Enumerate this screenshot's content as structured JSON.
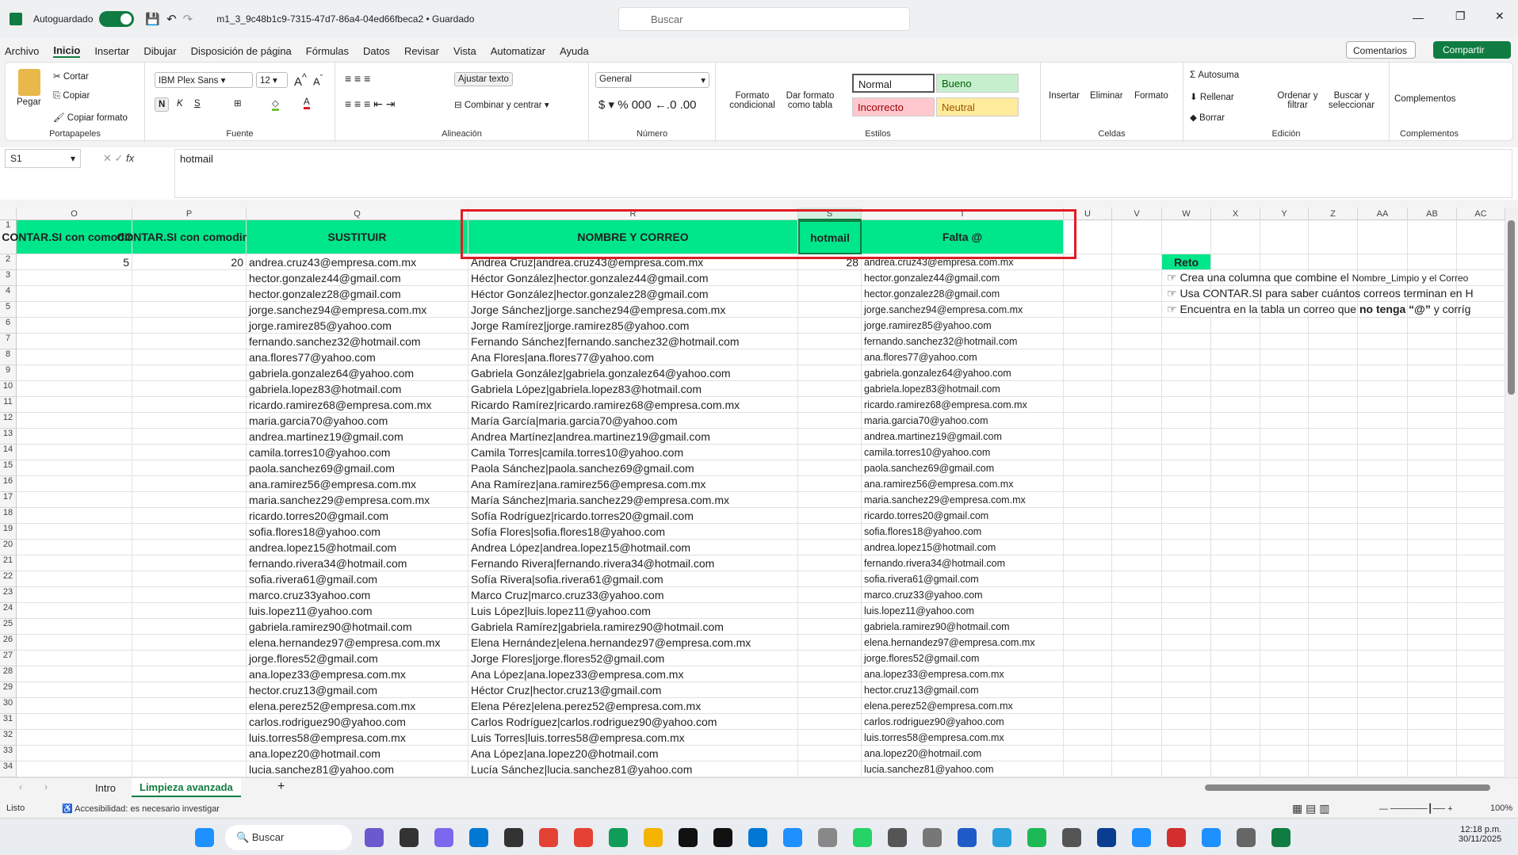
{
  "titlebar": {
    "autosave": "Autoguardado",
    "filename": "m1_3_9c48b1c9-7315-47d7-86a4-04ed66fbeca2 • Guardado",
    "search_placeholder": "Buscar"
  },
  "menu": [
    "Archivo",
    "Inicio",
    "Insertar",
    "Dibujar",
    "Disposición de página",
    "Fórmulas",
    "Datos",
    "Revisar",
    "Vista",
    "Automatizar",
    "Ayuda"
  ],
  "menu_active": "Inicio",
  "actions": {
    "comments": "Comentarios",
    "share": "Compartir"
  },
  "ribbon": {
    "clipboard": {
      "paste": "Pegar",
      "cut": "Cortar",
      "copy": "Copiar",
      "format_painter": "Copiar formato",
      "label": "Portapapeles"
    },
    "font": {
      "family": "IBM Plex Sans",
      "size": "12",
      "bold": "N",
      "italic": "K",
      "underline": "S",
      "label": "Fuente"
    },
    "alignment": {
      "wrap": "Ajustar texto",
      "merge": "Combinar y centrar",
      "label": "Alineación"
    },
    "number": {
      "format": "General",
      "label": "Número"
    },
    "styles": {
      "conditional": "Formato condicional",
      "table": "Dar formato como tabla",
      "normal": "Normal",
      "good": "Bueno",
      "bad": "Incorrecto",
      "neutral": "Neutral",
      "label": "Estilos"
    },
    "cells": {
      "insert": "Insertar",
      "delete": "Eliminar",
      "format": "Formato",
      "label": "Celdas"
    },
    "editing": {
      "autosum": "Autosuma",
      "fill": "Rellenar",
      "clear": "Borrar",
      "sort": "Ordenar y filtrar",
      "find": "Buscar y seleccionar",
      "label": "Edición"
    },
    "addins": {
      "addins": "Complementos",
      "label": "Complementos"
    }
  },
  "formula_bar": {
    "cell": "S1",
    "formula": "hotmail"
  },
  "columns": [
    "O",
    "P",
    "Q",
    "R",
    "S",
    "T",
    "U",
    "V",
    "W",
    "X",
    "Y",
    "Z",
    "AA",
    "AB",
    "AC"
  ],
  "headers": {
    "O": "CONTAR.SI con comodines",
    "P": "CONTAR.SI con comodines",
    "Q": "SUSTITUIR",
    "R": "NOMBRE Y CORREO",
    "S": "hotmail",
    "T": "Falta @"
  },
  "row2": {
    "O": "5",
    "P": "20",
    "S": "28"
  },
  "rows": [
    [
      "andrea.cruz43@empresa.com.mx",
      "Andrea Cruz|andrea.cruz43@empresa.com.mx",
      "andrea.cruz43@empresa.com.mx"
    ],
    [
      "hector.gonzalez44@gmail.com",
      "Héctor González|hector.gonzalez44@gmail.com",
      "hector.gonzalez44@gmail.com"
    ],
    [
      "hector.gonzalez28@gmail.com",
      "Héctor González|hector.gonzalez28@gmail.com",
      "hector.gonzalez28@gmail.com"
    ],
    [
      "jorge.sanchez94@empresa.com.mx",
      "Jorge Sánchez|jorge.sanchez94@empresa.com.mx",
      "jorge.sanchez94@empresa.com.mx"
    ],
    [
      "jorge.ramirez85@yahoo.com",
      "Jorge Ramírez|jorge.ramirez85@yahoo.com",
      "jorge.ramirez85@yahoo.com"
    ],
    [
      "fernando.sanchez32@hotmail.com",
      "Fernando Sánchez|fernando.sanchez32@hotmail.com",
      "fernando.sanchez32@hotmail.com"
    ],
    [
      "ana.flores77@yahoo.com",
      "Ana Flores|ana.flores77@yahoo.com",
      "ana.flores77@yahoo.com"
    ],
    [
      "gabriela.gonzalez64@yahoo.com",
      "Gabriela González|gabriela.gonzalez64@yahoo.com",
      "gabriela.gonzalez64@yahoo.com"
    ],
    [
      "gabriela.lopez83@hotmail.com",
      "Gabriela López|gabriela.lopez83@hotmail.com",
      "gabriela.lopez83@hotmail.com"
    ],
    [
      "ricardo.ramirez68@empresa.com.mx",
      "Ricardo Ramírez|ricardo.ramirez68@empresa.com.mx",
      "ricardo.ramirez68@empresa.com.mx"
    ],
    [
      "maria.garcia70@yahoo.com",
      "María García|maria.garcia70@yahoo.com",
      "maria.garcia70@yahoo.com"
    ],
    [
      "andrea.martinez19@gmail.com",
      "Andrea Martínez|andrea.martinez19@gmail.com",
      "andrea.martinez19@gmail.com"
    ],
    [
      "camila.torres10@yahoo.com",
      "Camila Torres|camila.torres10@yahoo.com",
      "camila.torres10@yahoo.com"
    ],
    [
      "paola.sanchez69@gmail.com",
      "Paola Sánchez|paola.sanchez69@gmail.com",
      "paola.sanchez69@gmail.com"
    ],
    [
      "ana.ramirez56@empresa.com.mx",
      "Ana Ramírez|ana.ramirez56@empresa.com.mx",
      "ana.ramirez56@empresa.com.mx"
    ],
    [
      "maria.sanchez29@empresa.com.mx",
      "María Sánchez|maria.sanchez29@empresa.com.mx",
      "maria.sanchez29@empresa.com.mx"
    ],
    [
      "ricardo.torres20@gmail.com",
      "Sofía Rodríguez|ricardo.torres20@gmail.com",
      "ricardo.torres20@gmail.com"
    ],
    [
      "sofia.flores18@yahoo.com",
      "Sofía Flores|sofia.flores18@yahoo.com",
      "sofia.flores18@yahoo.com"
    ],
    [
      "andrea.lopez15@hotmail.com",
      "Andrea López|andrea.lopez15@hotmail.com",
      "andrea.lopez15@hotmail.com"
    ],
    [
      "fernando.rivera34@hotmail.com",
      "Fernando Rivera|fernando.rivera34@hotmail.com",
      "fernando.rivera34@hotmail.com"
    ],
    [
      "sofia.rivera61@gmail.com",
      "Sofía Rivera|sofia.rivera61@gmail.com",
      "sofia.rivera61@gmail.com"
    ],
    [
      "marco.cruz33yahoo.com",
      "Marco Cruz|marco.cruz33@yahoo.com",
      "marco.cruz33@yahoo.com"
    ],
    [
      "luis.lopez11@yahoo.com",
      "Luis López|luis.lopez11@yahoo.com",
      "luis.lopez11@yahoo.com"
    ],
    [
      "gabriela.ramirez90@hotmail.com",
      "Gabriela Ramírez|gabriela.ramirez90@hotmail.com",
      "gabriela.ramirez90@hotmail.com"
    ],
    [
      "elena.hernandez97@empresa.com.mx",
      "Elena Hernández|elena.hernandez97@empresa.com.mx",
      "elena.hernandez97@empresa.com.mx"
    ],
    [
      "jorge.flores52@gmail.com",
      "Jorge Flores|jorge.flores52@gmail.com",
      "jorge.flores52@gmail.com"
    ],
    [
      "ana.lopez33@empresa.com.mx",
      "Ana López|ana.lopez33@empresa.com.mx",
      "ana.lopez33@empresa.com.mx"
    ],
    [
      "hector.cruz13@gmail.com",
      "Héctor Cruz|hector.cruz13@gmail.com",
      "hector.cruz13@gmail.com"
    ],
    [
      "elena.perez52@empresa.com.mx",
      "Elena Pérez|elena.perez52@empresa.com.mx",
      "elena.perez52@empresa.com.mx"
    ],
    [
      "carlos.rodriguez90@yahoo.com",
      "Carlos Rodríguez|carlos.rodriguez90@yahoo.com",
      "carlos.rodriguez90@yahoo.com"
    ],
    [
      "luis.torres58@empresa.com.mx",
      "Luis Torres|luis.torres58@empresa.com.mx",
      "luis.torres58@empresa.com.mx"
    ],
    [
      "ana.lopez20@hotmail.com",
      "Ana López|ana.lopez20@hotmail.com",
      "ana.lopez20@hotmail.com"
    ],
    [
      "lucia.sanchez81@yahoo.com",
      "Lucía Sánchez|lucia.sanchez81@yahoo.com",
      "lucia.sanchez81@yahoo.com"
    ]
  ],
  "reto": {
    "title": "Reto",
    "lines": [
      {
        "pre": "Crea una columna que combine el ",
        "small": "Nombre_Limpio y el Correo",
        "bold": "",
        "post": ""
      },
      {
        "pre": "Usa CONTAR.SI para saber cuántos correos terminan en H",
        "small": "",
        "bold": "",
        "post": ""
      },
      {
        "pre": "Encuentra en la tabla un correo que ",
        "small": "",
        "bold": "no tenga “@”",
        "post": " y corríg"
      }
    ]
  },
  "sheets": {
    "tabs": [
      "Intro",
      "Limpieza avanzada"
    ],
    "active": "Limpieza avanzada"
  },
  "status": {
    "ready": "Listo",
    "accessibility": "Accesibilidad: es necesario investigar",
    "zoom": "100%"
  },
  "taskbar": {
    "search": "Buscar",
    "time": "12:18 p.m.",
    "date": "30/11/2025"
  },
  "colors": {
    "excel_green": "#107c41",
    "header_fill": "#00e68a",
    "highlight_border": "#e01c24"
  }
}
